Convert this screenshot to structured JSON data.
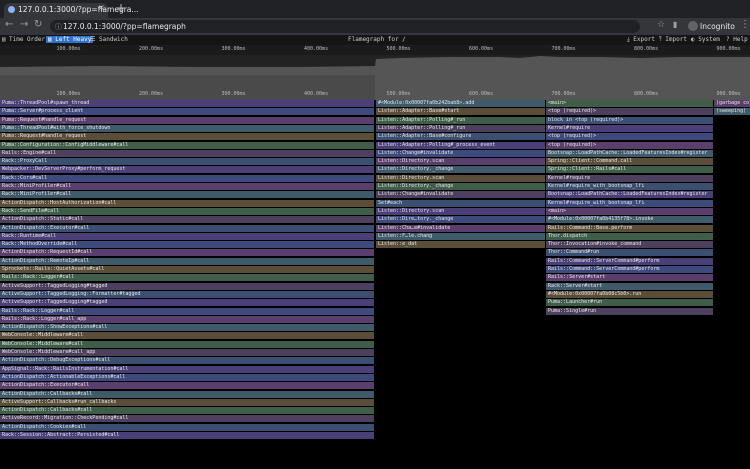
{
  "browser": {
    "tab_title": "127.0.0.1:3000/?pp=flamegra...",
    "url": "127.0.0.1:3000/?pp=flamegraph",
    "profile_label": "Incognito"
  },
  "speedscope": {
    "toolbar": {
      "time_order": "Time Order",
      "left_heavy": "Left Heavy",
      "sandwich": "Sandwich",
      "title": "Flamegraph for /",
      "export": "Export",
      "import": "Import",
      "system": "System",
      "help": "Help"
    },
    "ticks": [
      "100.00ms",
      "200.00ms",
      "300.00ms",
      "400.00ms",
      "500.00ms",
      "600.00ms",
      "700.00ms",
      "800.00ms",
      "900.00ms"
    ],
    "colors": {
      "accent": "#2f72ce"
    }
  },
  "frames_col1": [
    "Puma::ThreadPool#spawn_thread",
    "Puma::Server#process_client",
    "Puma::Request#handle_request",
    "Puma::ThreadPool#with_force_shutdown",
    "Puma::Request#handle_request",
    "Puma::Configuration::ConfigMiddleware#call",
    "Rails::Engine#call",
    "Rack::ProxyCall",
    "Webpacker::DevServerProxy#perform_request",
    "Rack::Cors#call",
    "Rack::MiniProfiler#call",
    "Rack::MiniProfiler#call",
    "ActionDispatch::HostAuthorization#call",
    "Rack::SendFile#call",
    "ActionDispatch::Static#call",
    "ActionDispatch::Executor#call",
    "Rack::Runtime#call",
    "Rack::MethodOverride#call",
    "ActionDispatch::RequestId#call",
    "ActionDispatch::RemoteIp#call",
    "Sprockets::Rails::QuietAssets#call",
    "Rails::Rack::Logger#call",
    "ActiveSupport::TaggedLogging#tagged",
    "ActiveSupport::TaggedLogging::Formatter#tagged",
    "ActiveSupport::TaggedLogging#tagged",
    "Rails::Rack::Logger#call",
    "Rails::Rack::Logger#call_app",
    "ActionDispatch::ShowExceptions#call",
    "WebConsole::Middleware#call",
    "WebConsole::Middleware#call",
    "WebConsole::Middleware#call_app",
    "ActionDispatch::DebugExceptions#call",
    "AppSignal::Rack::RailsInstrumentation#call",
    "ActionDispatch::ActionableExceptions#call",
    "ActionDispatch::Executor#call",
    "ActionDispatch::Callbacks#call",
    "ActiveSupport::Callbacks#run_callbacks",
    "ActionDispatch::Callbacks#call",
    "ActiveRecord::Migration::CheckPending#call",
    "ActionDispatch::Cookies#call",
    "Rack::Session::Abstract::Persisted#call"
  ],
  "frames_col2": [
    "#<Module:0x00007fa0b242bab8>.add",
    "Listen::Adapter::Base#start",
    "Listen::Adapter::Polling#_run",
    "Listen::Adapter::Polling#_run",
    "Listen::Adapter::Base#configure",
    "Listen::Adapter::Polling#_process_event",
    "Listen::Change#invalidate",
    "Listen::Directory.scan",
    "Listen::Directory._change",
    "Listen::Directory.scan",
    "Listen::Directory._change",
    "Listen::Change#invalidate",
    "Set#each",
    "Listen::Directory.scan",
    "Listen::Dire…tory._change",
    "Listen::Cha…e#invalidate",
    "Listen::F…le.chang",
    "Listen::e_dat"
  ],
  "frames_col3": [
    "<main>",
    "<top (required)>",
    "block in <top (required)>",
    "Kernel#require",
    "<top (required)>",
    "<top (required)>",
    "Bootsnap::LoadPathCache::LoadedFeaturesIndex#register",
    "Spring::Client::Command.call",
    "Spring::Client::Rails#call",
    "Kernel#require",
    "Kernel#require_with_bootsnap_lfi",
    "Bootsnap::LoadPathCache::LoadedFeaturesIndex#register",
    "Kernel#require_with_bootsnap_lfi",
    "<main>",
    "#<Module:0x00007fa0b4135f78>.invoke",
    "Rails::Command::Base.perform",
    "Thor.dispatch",
    "Thor::Invocation#invoke_command",
    "Thor::Command#run",
    "Rails::Command::ServerCommand#perform",
    "Rails::Command::ServerCommand#perform",
    "Rails::Server#start",
    "Rack::Server#start",
    "#<Module:0x00007fa0b08c5b0>.run",
    "Puma::Launcher#run",
    "Puma::Single#run"
  ],
  "frames_col4": [
    "(garbage collection)",
    "(sweeping)"
  ]
}
